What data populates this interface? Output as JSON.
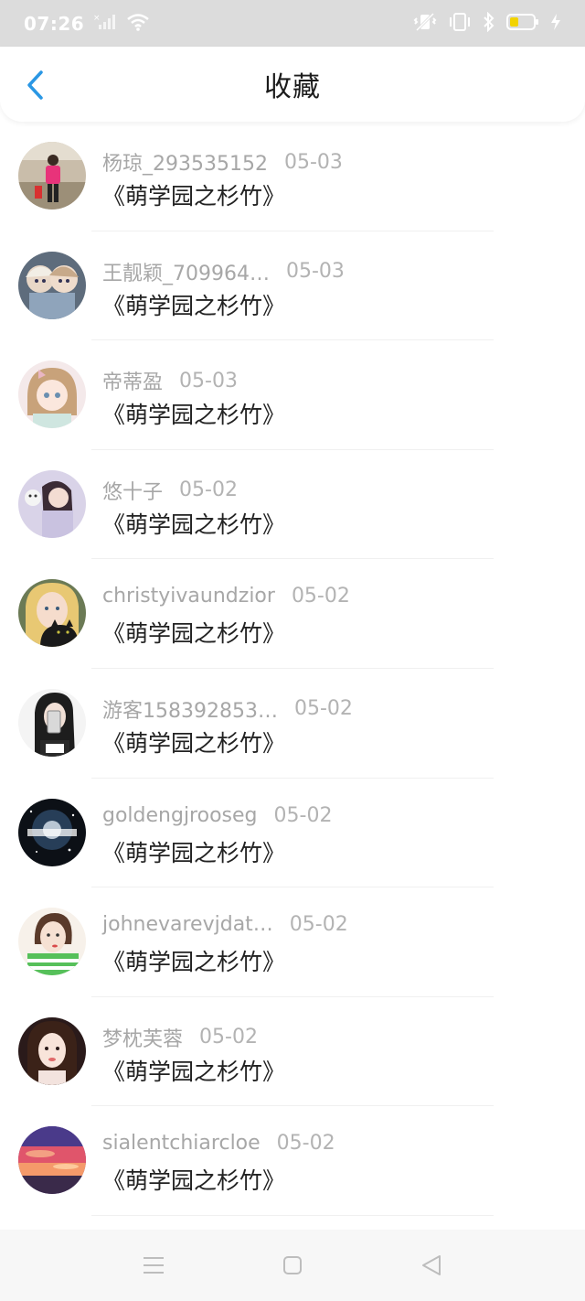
{
  "status_bar": {
    "time": "07:26",
    "icons": [
      "sim-x-icon",
      "signal-icon",
      "wifi-icon",
      "vibrate-icon",
      "bluetooth-icon",
      "battery-icon",
      "charging-icon"
    ]
  },
  "header": {
    "title": "收藏",
    "back_icon": "chevron-left-icon",
    "accent": "#2a97e4"
  },
  "favorites": [
    {
      "username": "杨琼_293535152",
      "date": "05-03",
      "title": "《萌学园之杉竹》",
      "avatar": "person-pink-jacket"
    },
    {
      "username": "王靓颖_709964…",
      "date": "05-03",
      "title": "《萌学园之杉竹》",
      "avatar": "anime-two-girls"
    },
    {
      "username": "帝蒂盈",
      "date": "05-03",
      "title": "《萌学园之杉竹》",
      "avatar": "anime-girl-bow"
    },
    {
      "username": "悠十子",
      "date": "05-02",
      "title": "《萌学园之杉竹》",
      "avatar": "girl-with-pet"
    },
    {
      "username": "christyivaundzior",
      "date": "05-02",
      "title": "《萌学园之杉竹》",
      "avatar": "blonde-girl-black-cat"
    },
    {
      "username": "游客158392853…",
      "date": "05-02",
      "title": "《萌学园之杉竹》",
      "avatar": "girl-phone-selfie"
    },
    {
      "username": "goldengjrooseg",
      "date": "05-02",
      "title": "《萌学园之杉竹》",
      "avatar": "night-sky-text"
    },
    {
      "username": "johnevarevjdat…",
      "date": "05-02",
      "title": "《萌学园之杉竹》",
      "avatar": "illustrated-girl-green"
    },
    {
      "username": "梦枕芙蓉",
      "date": "05-02",
      "title": "《萌学园之杉竹》",
      "avatar": "girl-portrait"
    },
    {
      "username": "sialentchiarcloe",
      "date": "05-02",
      "title": "《萌学园之杉竹》",
      "avatar": "sunset-landscape"
    }
  ],
  "nav_bar": {
    "buttons": [
      "menu-icon",
      "home-square-icon",
      "back-triangle-icon"
    ]
  }
}
